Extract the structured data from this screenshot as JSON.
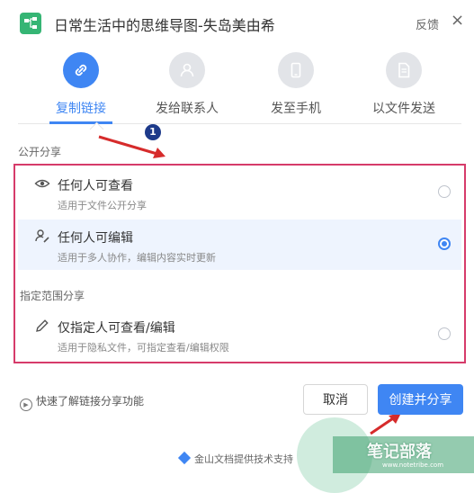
{
  "header": {
    "title": "日常生活中的思维导图-失岛美由希",
    "feedback": "反馈",
    "close": "×"
  },
  "tabs": [
    {
      "label": "复制链接",
      "icon": "link-icon",
      "active": true
    },
    {
      "label": "发给联系人",
      "icon": "user-icon",
      "active": false
    },
    {
      "label": "发至手机",
      "icon": "phone-icon",
      "active": false
    },
    {
      "label": "以文件发送",
      "icon": "file-icon",
      "active": false
    }
  ],
  "annotation": {
    "badge": "1"
  },
  "public_share": {
    "label": "公开分享",
    "options": [
      {
        "title": "任何人可查看",
        "desc": "适用于文件公开分享",
        "icon": "eye-icon",
        "selected": false
      },
      {
        "title": "任何人可编辑",
        "desc": "适用于多人协作，编辑内容实时更新",
        "icon": "user-edit-icon",
        "selected": true
      }
    ]
  },
  "restricted_share": {
    "label": "指定范围分享",
    "options": [
      {
        "title": "仅指定人可查看/编辑",
        "desc": "适用于隐私文件，可指定查看/编辑权限",
        "icon": "pencil-icon",
        "selected": false
      }
    ]
  },
  "footer": {
    "learn": "快速了解链接分享功能",
    "cancel": "取消",
    "create": "创建并分享",
    "support": "金山文档提供技术支持"
  },
  "watermark": {
    "text": "笔记部落",
    "url": "www.notetribe.com"
  },
  "colors": {
    "accent": "#3f86f3",
    "highlight": "#d63b6a",
    "arrow": "#d62b2b"
  }
}
